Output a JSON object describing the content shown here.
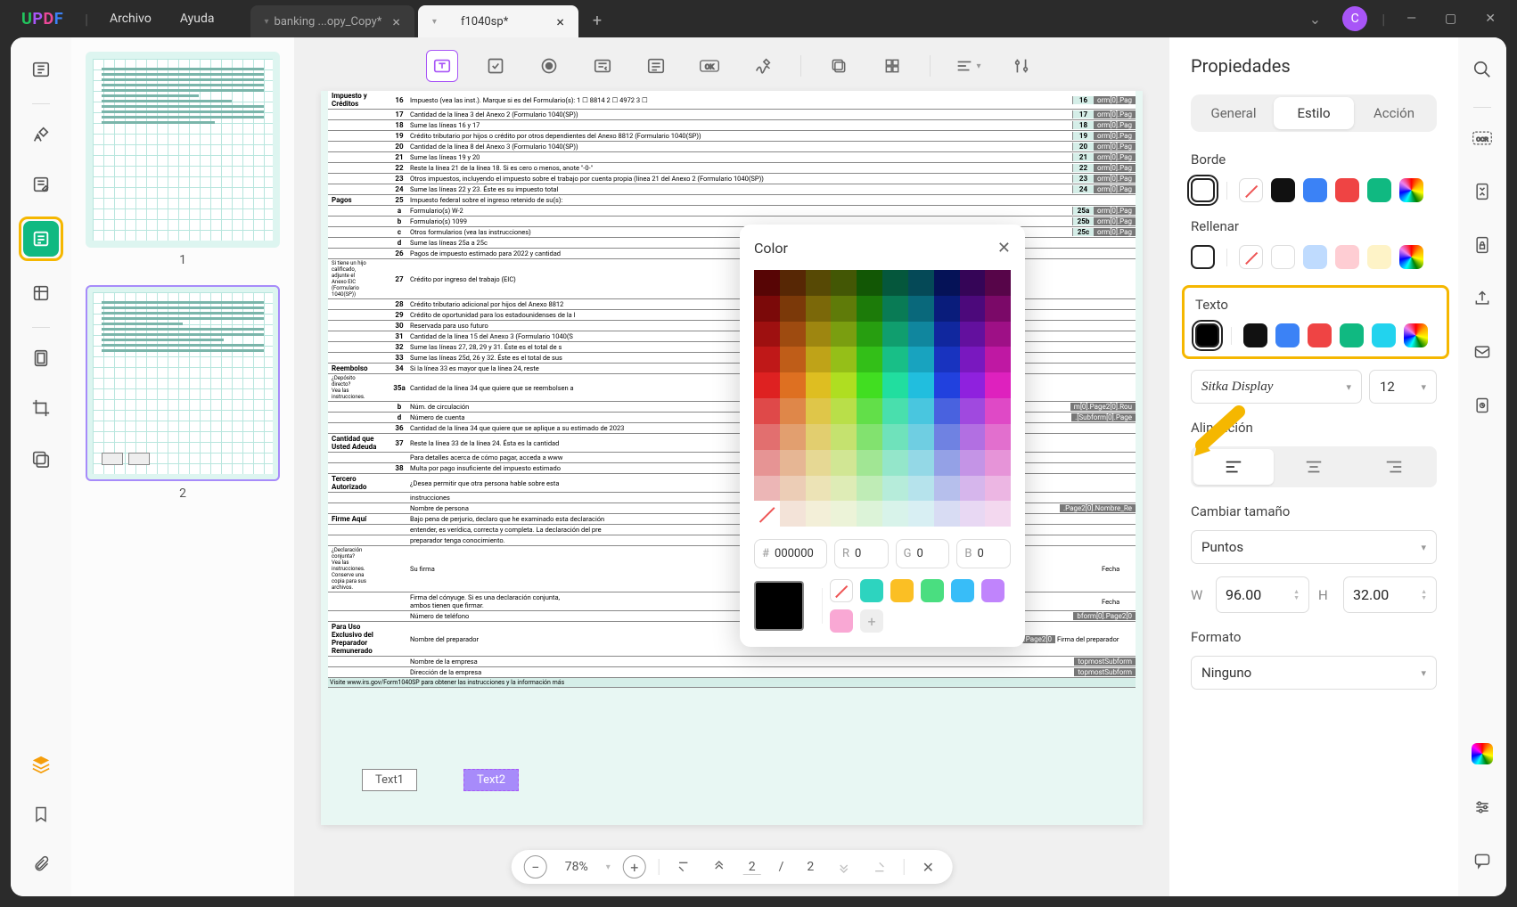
{
  "app": {
    "logo": "UPDF"
  },
  "menu": {
    "file": "Archivo",
    "help": "Ayuda"
  },
  "tabs": [
    {
      "title": "banking ...opy_Copy*",
      "active": false
    },
    {
      "title": "f1040sp*",
      "active": true
    }
  ],
  "avatar_initial": "C",
  "thumbs": {
    "p1": "1",
    "p2": "2"
  },
  "text_fields": {
    "t1": "Text1",
    "t2": "Text2"
  },
  "zoom": {
    "value": "78%",
    "page_cur": "2",
    "page_sep": "/",
    "page_tot": "2"
  },
  "color_popup": {
    "title": "Color",
    "hex_label": "#",
    "hex_value": "000000",
    "r_label": "R",
    "r_value": "0",
    "g_label": "G",
    "g_value": "0",
    "b_label": "B",
    "b_value": "0",
    "preset_colors": [
      "#2dd4bf",
      "#fbbf24",
      "#4ade80",
      "#38bdf8",
      "#c084fc",
      "#f9a8d4"
    ]
  },
  "props": {
    "title": "Propiedades",
    "tabs": {
      "general": "General",
      "style": "Estilo",
      "action": "Acción"
    },
    "border": "Borde",
    "fill": "Rellenar",
    "text": "Texto",
    "font": "Sitka Display",
    "font_size": "12",
    "alignment": "Alineación",
    "resize": "Cambiar tamaño",
    "units": "Puntos",
    "w_label": "W",
    "w_value": "96.00",
    "h_label": "H",
    "h_value": "32.00",
    "format": "Formato",
    "format_value": "Ninguno"
  },
  "form": {
    "section_tax": "Impuesto y Créditos",
    "section_payments": "Pagos",
    "section_refund": "Reembolso",
    "section_amount": "Cantidad que Usted Adeuda",
    "section_third": "Tercero Autorizado",
    "section_sign": "Firme Aquí",
    "section_prep": "Para Uso Exclusivo del Preparador Remunerado",
    "r16": "Impuesto (vea las inst.). Marque si es del Formulario(s): 1 ☐ 8814  2 ☐ 4972  3 ☐",
    "r17": "Cantidad de la línea 3 del Anexo 2 (Formulario 1040(SP))",
    "r18": "Sume las líneas 16 y 17",
    "r19": "Crédito tributario por hijos o crédito por otros dependientes del Anexo 8812 (Formulario 1040(SP))",
    "r20": "Cantidad de la línea 8 del Anexo 3 (Formulario 1040(SP))",
    "r21": "Sume las líneas 19 y 20",
    "r22": "Reste la línea 21 de la línea 18. Si es cero o menos, anote \"-0-\"",
    "r23": "Otros impuestos, incluyendo el impuesto sobre el trabajo por cuenta propia (línea 21 del Anexo 2 (Formulario 1040(SP))",
    "r24": "Sume las líneas 22 y 23. Éste es su impuesto total",
    "r25": "Impuesto federal sobre el ingreso retenido de su(s):",
    "r25a": "Formulario(s) W-2",
    "r25b": "Formulario(s) 1099",
    "r25c": "Otros formularios (vea las instrucciones)",
    "r25d": "Sume las líneas 25a a 25c",
    "r26": "Pagos de impuesto estimado para 2022 y cantidad",
    "r27": "Crédito por ingreso del trabajo (EIC)",
    "r28": "Crédito tributario adicional por hijos del Anexo 8812",
    "r29": "Crédito de oportunidad para los estadounidenses de la l",
    "r30": "Reservada para uso futuro",
    "r31": "Cantidad de la línea 15 del Anexo 3 (Formulario 1040(S",
    "r32": "Sume las líneas 27, 28, 29 y 31. Éste es el total de s",
    "r33": "Sume las líneas 25d, 26 y 32. Éste es el total de sus",
    "r34": "Si la línea 33 es mayor que la línea 24, reste",
    "r35a": "Cantidad de la línea 34 que quiere que se reembolsen a",
    "r35b": "Núm. de circulación",
    "r35d": "Número de cuenta",
    "r36": "Cantidad de la línea 34 que quiere que se aplique a su estimado de 2023",
    "r37": "Reste la línea 33 de la línea 24. Ésta es la cantidad",
    "r38": "Multa por pago insuficiente del impuesto estimado",
    "r37b": "Para detalles acerca de cómo pagar, acceda a www",
    "rthird": "¿Desea permitir que otra persona hable sobre esta",
    "field35b": "m[0].Page2[0].Rou",
    "field35d": ".[Subform[0].Page",
    "fieldname": ".Page2[0].Nombre_Re",
    "fieldtel": "bform[0].Page2[0",
    "fieldprep": "ubform[0].Page2[0",
    "fieldfirm": "topmostSubform",
    "lbl_hijo": "Si tiene un hijo\ncalificado,\nadjunte el\nAnexo EIC\n(Formulario\n1040(SP))",
    "lbl_deposito": "¿Depósito\ndirecto?\nVea las\ninstrucciones.",
    "lbl_decl": "¿Declaración\nconjunta?\nVea las\ninstrucciones.\nConserve una\ncopia para sus\narchivos.",
    "lbl_nombre": "Nombre de\npersona",
    "lbl_bajo": "Bajo pena de perjurio, declaro que he examinado esta declaración",
    "lbl_bajo2": "entender, es verídica, correcta y completa. La declaración del pre",
    "lbl_bajo3": "preparador tenga conocimiento.",
    "lbl_sufirma": "Su firma",
    "lbl_fecha": "Fecha",
    "lbl_conyuge": "Firma del cónyuge. Si es una declaración conjunta,\nambos tienen que firmar.",
    "lbl_tel": "Número de teléfono",
    "lbl_prepname": "Nombre del preparador",
    "lbl_firmname": "Nombre de la empresa",
    "lbl_firmaddr": "Dirección de la empresa",
    "lbl_prepfirma": "Firma del preparador",
    "lbl_instr": "instrucciones",
    "lbl_visit": "Visite www.irs.gov/Form1040SP para obtener las instrucciones y la información más",
    "form_tag": "orm[0].Pag"
  }
}
